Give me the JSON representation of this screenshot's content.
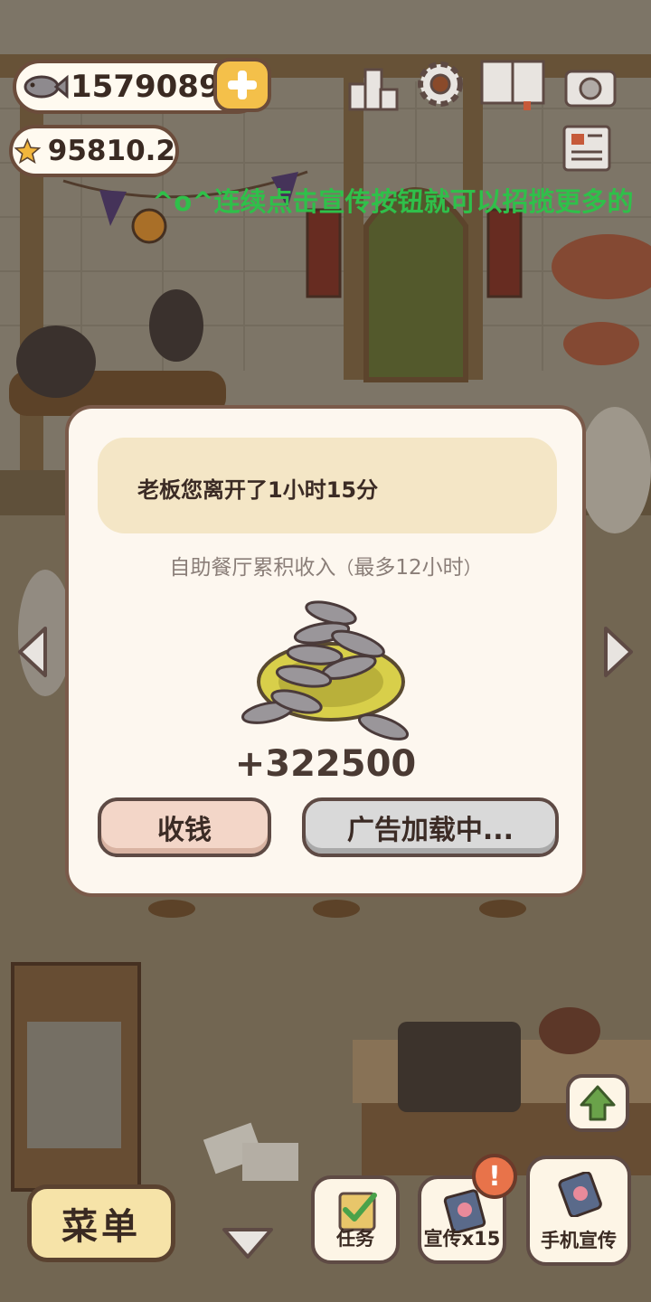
{
  "hud": {
    "fish_currency": "15790892",
    "star_currency": "95810.2",
    "marquee": "^o^连续点击宣传按钮就可以招揽更多的"
  },
  "top_icons": [
    "ranking-icon",
    "settings-gear-icon",
    "recipe-book-icon",
    "camera-icon",
    "newspaper-icon"
  ],
  "dialog": {
    "notice": "老板您离开了1小时15分",
    "subtitle_main": "自助餐厅累积收入",
    "subtitle_paren_open": "（",
    "subtitle_limit": "最多12小时",
    "subtitle_paren_close": "）",
    "amount": "+322500",
    "collect_label": "收钱",
    "ad_label": "广告加载中..."
  },
  "bottom": {
    "menu_label": "菜单",
    "tasks_label": "任务",
    "promote_label": "宣传x15",
    "alert": "!",
    "phone_promote_label": "手机宣传"
  },
  "colors": {
    "marquee": "#2fc04a",
    "collect_button": "#f3d6c8",
    "ad_button": "#d9d9d9",
    "menu_button": "#f6e3a8",
    "alert_badge": "#e8734a"
  }
}
